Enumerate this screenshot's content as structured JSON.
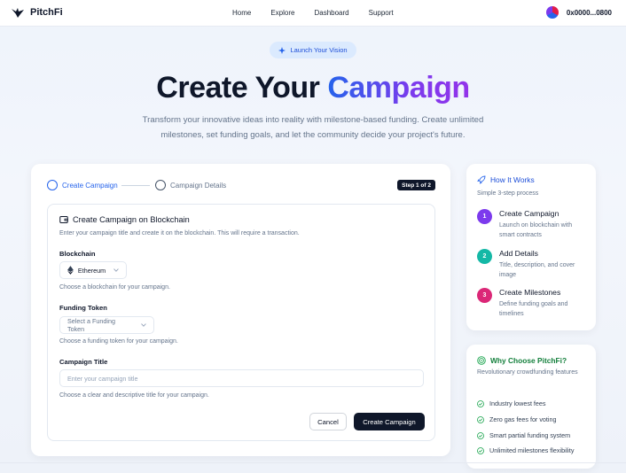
{
  "nav": {
    "brand": "PitchFi",
    "links": [
      "Home",
      "Explore",
      "Dashboard",
      "Support"
    ],
    "wallet_address": "0x0000...0800"
  },
  "hero": {
    "badge": "Launch Your Vision",
    "title_plain": "Create Your",
    "title_highlight": "Campaign",
    "subtitle_line1": "Transform your innovative ideas into reality with milestone-based funding. Create unlimited",
    "subtitle_line2": "milestones, set funding goals, and let the community decide your project's future."
  },
  "stepper": {
    "step1": "Create Campaign",
    "step2": "Campaign Details",
    "badge": "Step 1 of 2"
  },
  "form": {
    "title": "Create Campaign on Blockchain",
    "description": "Enter your campaign title and create it on the blockchain. This will require a transaction.",
    "blockchain_label": "Blockchain",
    "blockchain_value": "Ethereum",
    "blockchain_help": "Choose a blockchain for your campaign.",
    "token_label": "Funding Token",
    "token_placeholder": "Select a Funding Token",
    "token_help": "Choose a funding token for your campaign.",
    "title_label": "Campaign Title",
    "title_placeholder": "Enter your campaign title",
    "title_help": "Choose a clear and descriptive title for your campaign.",
    "cancel": "Cancel",
    "submit": "Create Campaign"
  },
  "how": {
    "title": "How It Works",
    "subtitle": "Simple 3-step process",
    "steps": [
      {
        "num": "1",
        "title": "Create Campaign",
        "desc": "Launch on blockchain with smart contracts",
        "color": "#7c3aed"
      },
      {
        "num": "2",
        "title": "Add Details",
        "desc": "Title, description, and cover image",
        "color": "#14b8a6"
      },
      {
        "num": "3",
        "title": "Create Milestones",
        "desc": "Define funding goals and timelines",
        "color": "#db2777"
      }
    ]
  },
  "why": {
    "title": "Why Choose PitchFi?",
    "subtitle": "Revolutionary crowdfunding features",
    "features": [
      "Industry lowest fees",
      "Zero gas fees for voting",
      "Smart partial funding system",
      "Unlimited milestones flexibility"
    ]
  },
  "colors": {
    "accent_blue": "#2563eb",
    "accent_purple": "#7c3aed",
    "success_green": "#16a34a",
    "dark": "#0f172a"
  }
}
